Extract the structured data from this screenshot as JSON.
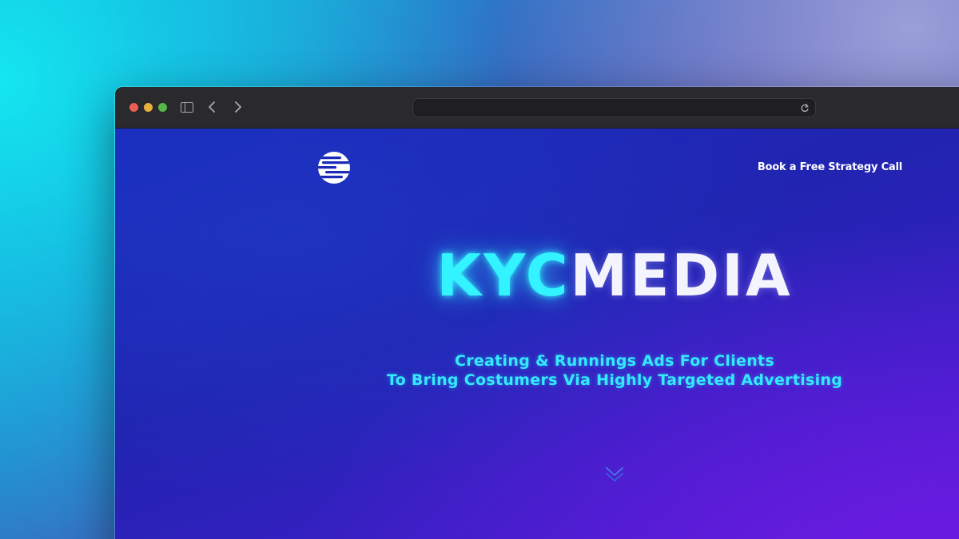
{
  "browser": {
    "address": "",
    "icons": [
      "close-dot",
      "minimize-dot",
      "zoom-dot",
      "sidebar-icon",
      "back-icon",
      "forward-icon",
      "reload-icon"
    ]
  },
  "page": {
    "logo_icon": "globe-logo-icon",
    "cta_label": "Book a Free Strategy Call",
    "title_part1": "KYC",
    "title_part2": "MEDIA",
    "subtitle_line1": "Creating & Runnings Ads For Clients",
    "subtitle_line2": "To Bring Costumers Via Highly Targeted Advertising",
    "scroll_icon": "chevron-down-icon"
  },
  "colors": {
    "accent_cyan": "#32f3ff",
    "background_blue": "#1a2bbd",
    "background_purple": "#5a1ad8",
    "toolbar": "#2a2a2d"
  }
}
